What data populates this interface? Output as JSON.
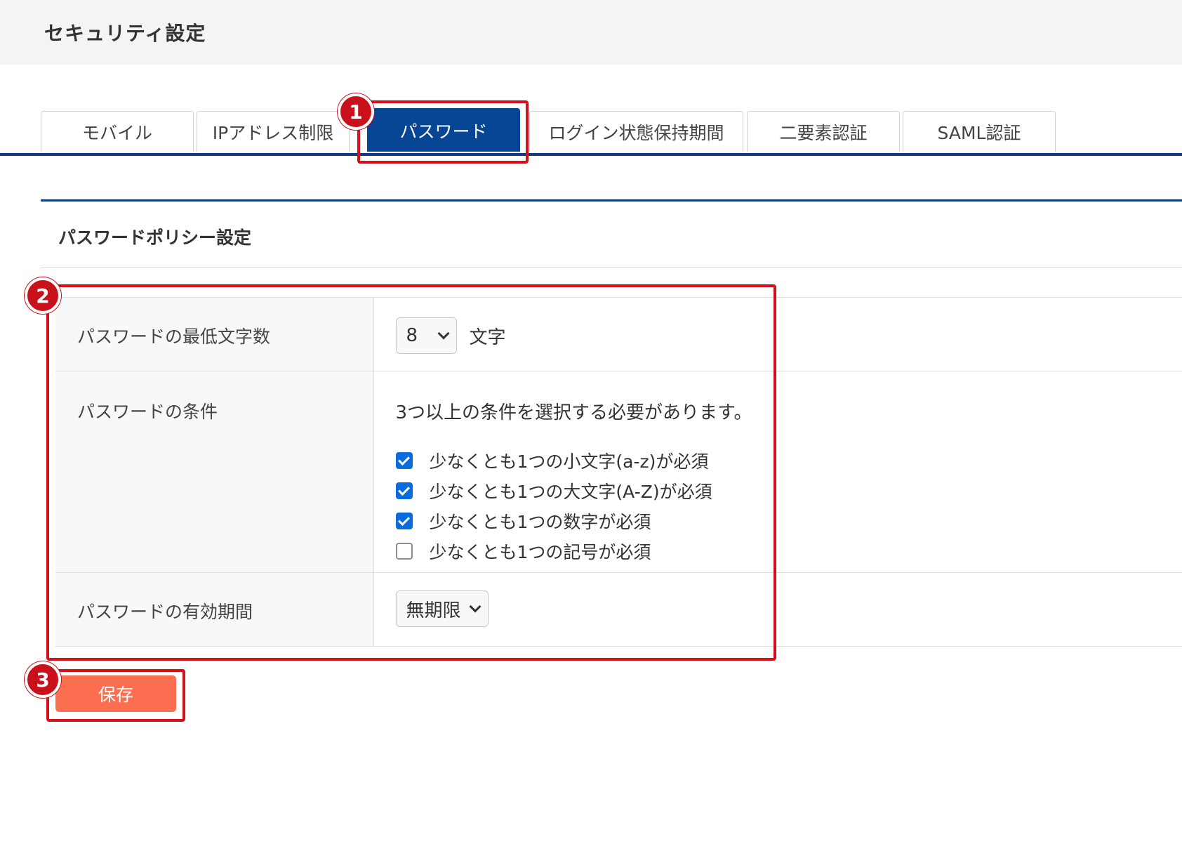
{
  "page": {
    "title": "セキュリティ設定"
  },
  "tabs": [
    {
      "label": "モバイル",
      "active": false
    },
    {
      "label": "IPアドレス制限",
      "active": false
    },
    {
      "label": "パスワード",
      "active": true
    },
    {
      "label": "ログイン状態保持期間",
      "active": false
    },
    {
      "label": "二要素認証",
      "active": false
    },
    {
      "label": "SAML認証",
      "active": false
    }
  ],
  "section": {
    "title": "パスワードポリシー設定"
  },
  "settings": {
    "min_length": {
      "label": "パスワードの最低文字数",
      "value": "8",
      "unit": "文字"
    },
    "conditions": {
      "label": "パスワードの条件",
      "note": "3つ以上の条件を選択する必要があります。",
      "options": [
        {
          "label": "少なくとも1つの小文字(a-z)が必須",
          "checked": true
        },
        {
          "label": "少なくとも1つの大文字(A-Z)が必須",
          "checked": true
        },
        {
          "label": "少なくとも1つの数字が必須",
          "checked": true
        },
        {
          "label": "少なくとも1つの記号が必須",
          "checked": false
        }
      ]
    },
    "expiration": {
      "label": "パスワードの有効期間",
      "value": "無期限"
    }
  },
  "actions": {
    "save_label": "保存"
  },
  "callouts": [
    "1",
    "2",
    "3"
  ],
  "colors": {
    "primary": "#074694",
    "accent": "#fb6f50",
    "callout": "#d3111d",
    "checkbox": "#0a6cdc"
  }
}
